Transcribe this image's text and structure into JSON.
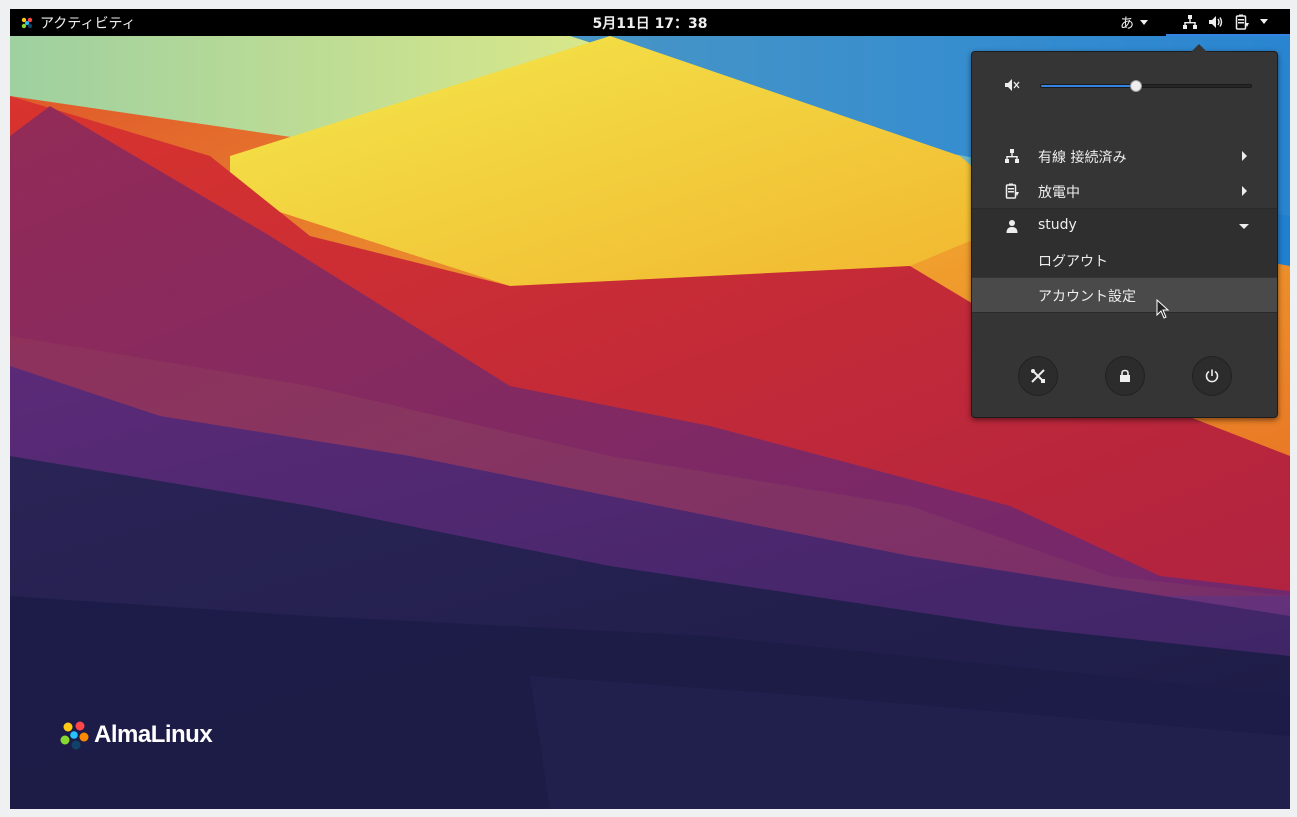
{
  "topbar": {
    "activities_label": "アクティビティ",
    "clock": "5月11日 17：38",
    "input_method": "あ"
  },
  "system_menu": {
    "volume": {
      "level": 0.45,
      "icon": "speaker-muted-icon"
    },
    "network": {
      "label": "有線 接続済み",
      "icon": "wired-network-icon"
    },
    "battery": {
      "label": "放電中",
      "icon": "battery-icon"
    },
    "user": {
      "name": "study",
      "icon": "user-icon",
      "items": [
        {
          "label": "ログアウト"
        },
        {
          "label": "アカウント設定"
        }
      ]
    },
    "buttons": [
      {
        "name": "settings-button",
        "icon": "tools-icon"
      },
      {
        "name": "lock-button",
        "icon": "lock-icon"
      },
      {
        "name": "power-button",
        "icon": "power-icon"
      }
    ]
  },
  "desktop": {
    "brand": "AlmaLinux",
    "accent_color": "#3584e4"
  }
}
